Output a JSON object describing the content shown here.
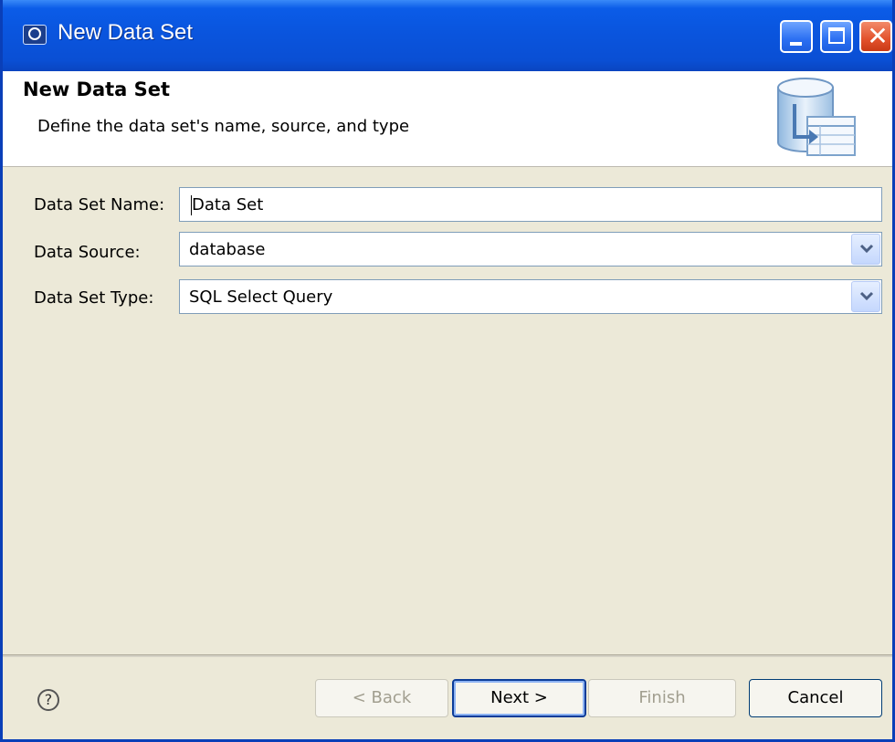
{
  "window": {
    "title": "New Data Set",
    "icons": {
      "app": "hp-logo-icon",
      "minimize": "minimize-icon",
      "maximize": "maximize-icon",
      "close": "close-icon"
    },
    "close_glyph": "✕"
  },
  "banner": {
    "title": "New Data Set",
    "description": "Define the data set's name, source, and type",
    "icon": "database-table-icon"
  },
  "form": {
    "name_label": "Data Set Name:",
    "name_value": "Data Set",
    "source_label": "Data Source:",
    "source_value": "database",
    "type_label": "Data Set Type:",
    "type_value": "SQL Select Query"
  },
  "footer": {
    "help_glyph": "?",
    "back_label": "< Back",
    "next_label": "Next >",
    "finish_label": "Finish",
    "cancel_label": "Cancel"
  },
  "colors": {
    "titlebar": "#0a55de",
    "dialog_bg": "#ece9d8",
    "disabled_text": "#a19e8f"
  }
}
